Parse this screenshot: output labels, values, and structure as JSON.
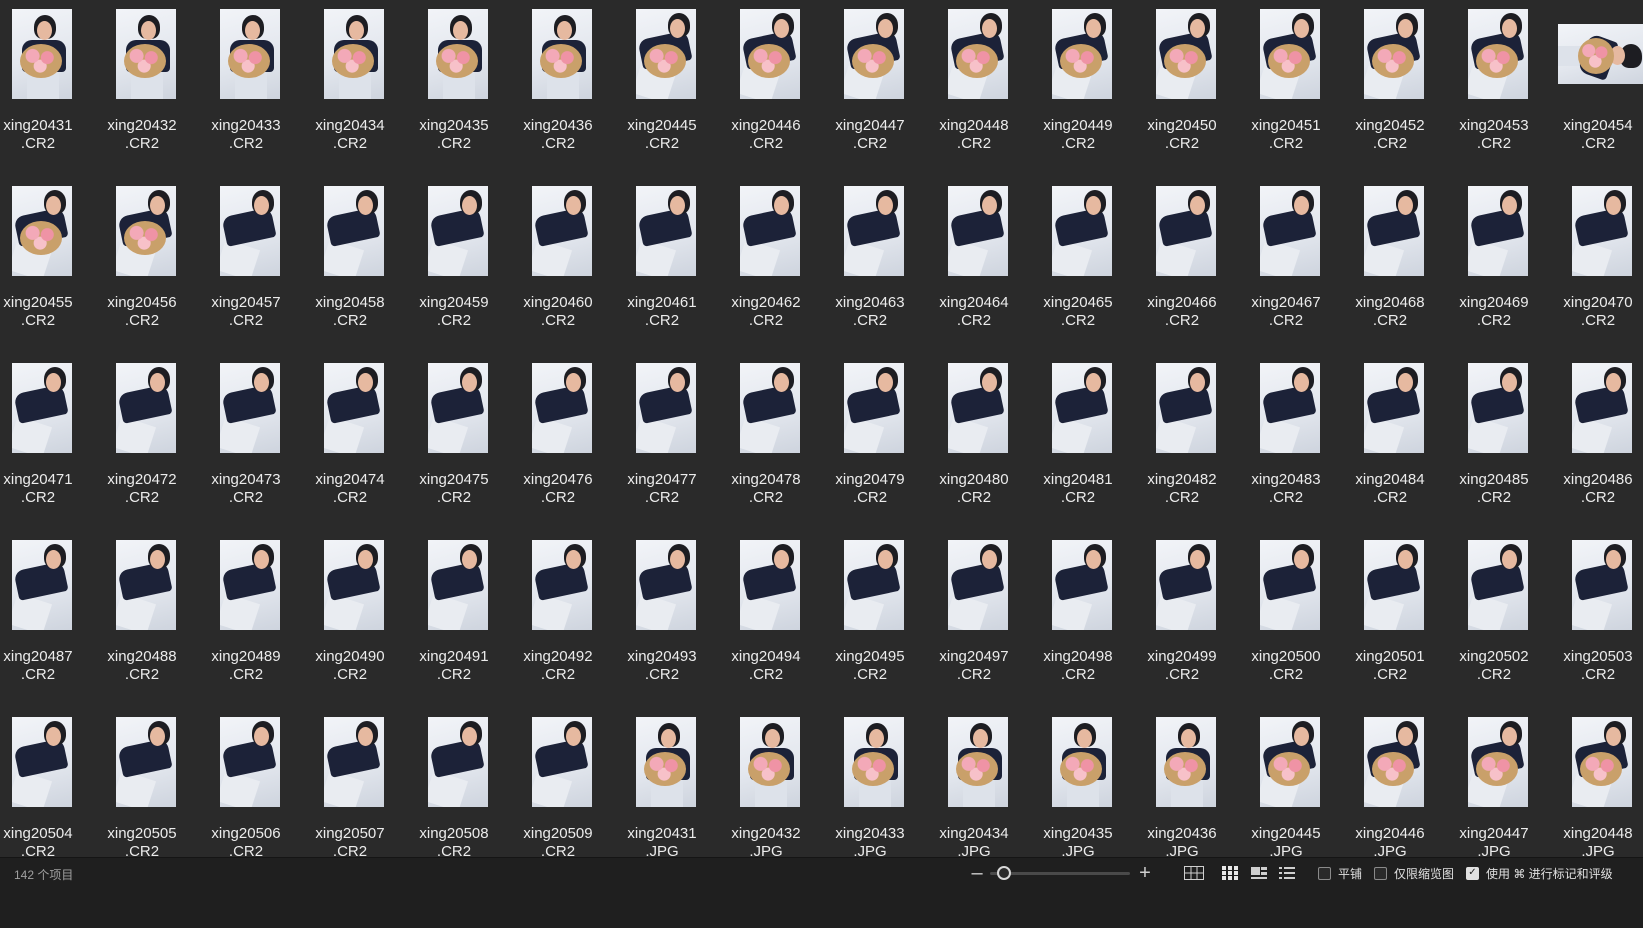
{
  "files": [
    {
      "name": "xing20431",
      "ext": ".CR2",
      "thumb": "bouquet"
    },
    {
      "name": "xing20432",
      "ext": ".CR2",
      "thumb": "bouquet"
    },
    {
      "name": "xing20433",
      "ext": ".CR2",
      "thumb": "bouquet"
    },
    {
      "name": "xing20434",
      "ext": ".CR2",
      "thumb": "bouquet"
    },
    {
      "name": "xing20435",
      "ext": ".CR2",
      "thumb": "bouquet"
    },
    {
      "name": "xing20436",
      "ext": ".CR2",
      "thumb": "bouquet"
    },
    {
      "name": "xing20445",
      "ext": ".CR2",
      "thumb": "lying-bouquet"
    },
    {
      "name": "xing20446",
      "ext": ".CR2",
      "thumb": "lying-bouquet"
    },
    {
      "name": "xing20447",
      "ext": ".CR2",
      "thumb": "lying-bouquet"
    },
    {
      "name": "xing20448",
      "ext": ".CR2",
      "thumb": "lying-bouquet"
    },
    {
      "name": "xing20449",
      "ext": ".CR2",
      "thumb": "lying-bouquet"
    },
    {
      "name": "xing20450",
      "ext": ".CR2",
      "thumb": "lying-bouquet"
    },
    {
      "name": "xing20451",
      "ext": ".CR2",
      "thumb": "lying-bouquet"
    },
    {
      "name": "xing20452",
      "ext": ".CR2",
      "thumb": "lying-bouquet"
    },
    {
      "name": "xing20453",
      "ext": ".CR2",
      "thumb": "lying-bouquet"
    },
    {
      "name": "xing20454",
      "ext": ".CR2",
      "thumb": "landscape"
    },
    {
      "name": "xing20455",
      "ext": ".CR2",
      "thumb": "lying-bouquet"
    },
    {
      "name": "xing20456",
      "ext": ".CR2",
      "thumb": "lying-bouquet"
    },
    {
      "name": "xing20457",
      "ext": ".CR2",
      "thumb": "lying"
    },
    {
      "name": "xing20458",
      "ext": ".CR2",
      "thumb": "lying"
    },
    {
      "name": "xing20459",
      "ext": ".CR2",
      "thumb": "lying"
    },
    {
      "name": "xing20460",
      "ext": ".CR2",
      "thumb": "lying"
    },
    {
      "name": "xing20461",
      "ext": ".CR2",
      "thumb": "lying"
    },
    {
      "name": "xing20462",
      "ext": ".CR2",
      "thumb": "lying"
    },
    {
      "name": "xing20463",
      "ext": ".CR2",
      "thumb": "lying"
    },
    {
      "name": "xing20464",
      "ext": ".CR2",
      "thumb": "lying"
    },
    {
      "name": "xing20465",
      "ext": ".CR2",
      "thumb": "lying"
    },
    {
      "name": "xing20466",
      "ext": ".CR2",
      "thumb": "lying"
    },
    {
      "name": "xing20467",
      "ext": ".CR2",
      "thumb": "lying"
    },
    {
      "name": "xing20468",
      "ext": ".CR2",
      "thumb": "lying"
    },
    {
      "name": "xing20469",
      "ext": ".CR2",
      "thumb": "lying"
    },
    {
      "name": "xing20470",
      "ext": ".CR2",
      "thumb": "lying"
    },
    {
      "name": "xing20471",
      "ext": ".CR2",
      "thumb": "lying"
    },
    {
      "name": "xing20472",
      "ext": ".CR2",
      "thumb": "lying"
    },
    {
      "name": "xing20473",
      "ext": ".CR2",
      "thumb": "lying"
    },
    {
      "name": "xing20474",
      "ext": ".CR2",
      "thumb": "lying"
    },
    {
      "name": "xing20475",
      "ext": ".CR2",
      "thumb": "lying"
    },
    {
      "name": "xing20476",
      "ext": ".CR2",
      "thumb": "lying"
    },
    {
      "name": "xing20477",
      "ext": ".CR2",
      "thumb": "lying"
    },
    {
      "name": "xing20478",
      "ext": ".CR2",
      "thumb": "lying"
    },
    {
      "name": "xing20479",
      "ext": ".CR2",
      "thumb": "lying"
    },
    {
      "name": "xing20480",
      "ext": ".CR2",
      "thumb": "lying"
    },
    {
      "name": "xing20481",
      "ext": ".CR2",
      "thumb": "lying"
    },
    {
      "name": "xing20482",
      "ext": ".CR2",
      "thumb": "lying"
    },
    {
      "name": "xing20483",
      "ext": ".CR2",
      "thumb": "lying"
    },
    {
      "name": "xing20484",
      "ext": ".CR2",
      "thumb": "lying"
    },
    {
      "name": "xing20485",
      "ext": ".CR2",
      "thumb": "lying"
    },
    {
      "name": "xing20486",
      "ext": ".CR2",
      "thumb": "lying"
    },
    {
      "name": "xing20487",
      "ext": ".CR2",
      "thumb": "lying"
    },
    {
      "name": "xing20488",
      "ext": ".CR2",
      "thumb": "lying"
    },
    {
      "name": "xing20489",
      "ext": ".CR2",
      "thumb": "lying"
    },
    {
      "name": "xing20490",
      "ext": ".CR2",
      "thumb": "lying"
    },
    {
      "name": "xing20491",
      "ext": ".CR2",
      "thumb": "lying"
    },
    {
      "name": "xing20492",
      "ext": ".CR2",
      "thumb": "lying"
    },
    {
      "name": "xing20493",
      "ext": ".CR2",
      "thumb": "lying"
    },
    {
      "name": "xing20494",
      "ext": ".CR2",
      "thumb": "lying"
    },
    {
      "name": "xing20495",
      "ext": ".CR2",
      "thumb": "lying"
    },
    {
      "name": "xing20497",
      "ext": ".CR2",
      "thumb": "lying"
    },
    {
      "name": "xing20498",
      "ext": ".CR2",
      "thumb": "lying"
    },
    {
      "name": "xing20499",
      "ext": ".CR2",
      "thumb": "lying"
    },
    {
      "name": "xing20500",
      "ext": ".CR2",
      "thumb": "lying"
    },
    {
      "name": "xing20501",
      "ext": ".CR2",
      "thumb": "lying"
    },
    {
      "name": "xing20502",
      "ext": ".CR2",
      "thumb": "lying"
    },
    {
      "name": "xing20503",
      "ext": ".CR2",
      "thumb": "lying"
    },
    {
      "name": "xing20504",
      "ext": ".CR2",
      "thumb": "lying"
    },
    {
      "name": "xing20505",
      "ext": ".CR2",
      "thumb": "lying"
    },
    {
      "name": "xing20506",
      "ext": ".CR2",
      "thumb": "lying"
    },
    {
      "name": "xing20507",
      "ext": ".CR2",
      "thumb": "lying"
    },
    {
      "name": "xing20508",
      "ext": ".CR2",
      "thumb": "lying"
    },
    {
      "name": "xing20509",
      "ext": ".CR2",
      "thumb": "lying"
    },
    {
      "name": "xing20431",
      "ext": ".JPG",
      "thumb": "bouquet"
    },
    {
      "name": "xing20432",
      "ext": ".JPG",
      "thumb": "bouquet"
    },
    {
      "name": "xing20433",
      "ext": ".JPG",
      "thumb": "bouquet"
    },
    {
      "name": "xing20434",
      "ext": ".JPG",
      "thumb": "bouquet"
    },
    {
      "name": "xing20435",
      "ext": ".JPG",
      "thumb": "bouquet"
    },
    {
      "name": "xing20436",
      "ext": ".JPG",
      "thumb": "bouquet"
    },
    {
      "name": "xing20445",
      "ext": ".JPG",
      "thumb": "lying-bouquet"
    },
    {
      "name": "xing20446",
      "ext": ".JPG",
      "thumb": "lying-bouquet"
    },
    {
      "name": "xing20447",
      "ext": ".JPG",
      "thumb": "lying-bouquet"
    },
    {
      "name": "xing20448",
      "ext": ".JPG",
      "thumb": "lying-bouquet"
    }
  ],
  "statusbar": {
    "item_count": "142 个项目",
    "zoom_level": 0.05,
    "zoom_minus_icon": "minus-icon",
    "zoom_plus_icon": "plus-icon",
    "view_modes": [
      "grid-view-icon",
      "thumbnail-view-icon",
      "filmstrip-view-icon",
      "list-view-icon"
    ],
    "active_view": "thumbnail-view-icon",
    "option_tile": "平铺",
    "option_tile_checked": false,
    "option_thumbs_only": "仅限缩览图",
    "option_thumbs_only_checked": false,
    "option_rating": "使用 ⌘ 进行标记和评级",
    "option_rating_checked": true
  }
}
